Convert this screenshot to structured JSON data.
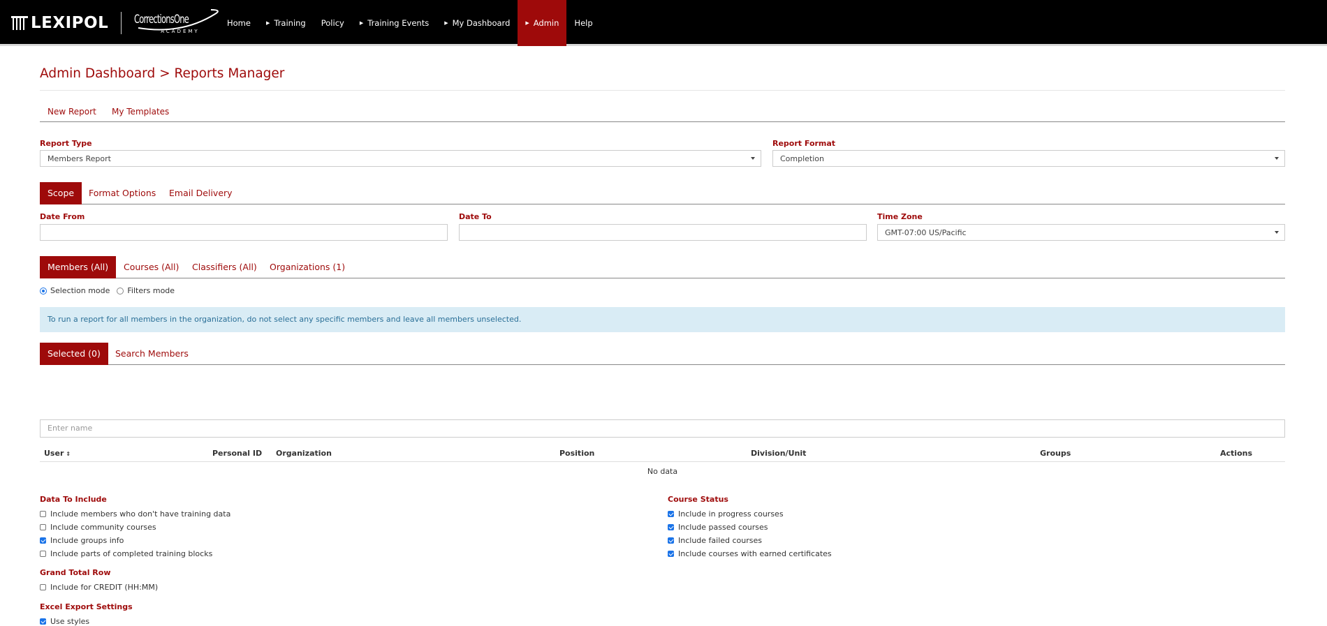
{
  "brand": {
    "lexipol": "LEXIPOL",
    "c1_name": "CorrectionsOne",
    "c1_sub": "ACADEMY"
  },
  "nav": [
    {
      "label": "Home",
      "caret": false,
      "active": false
    },
    {
      "label": "Training",
      "caret": true,
      "active": false
    },
    {
      "label": "Policy",
      "caret": false,
      "active": false
    },
    {
      "label": "Training Events",
      "caret": true,
      "active": false
    },
    {
      "label": "My Dashboard",
      "caret": true,
      "active": false
    },
    {
      "label": "Admin",
      "caret": true,
      "active": true
    },
    {
      "label": "Help",
      "caret": false,
      "active": false
    }
  ],
  "page_title": "Admin Dashboard > Reports Manager",
  "top_tabs": {
    "new_report": "New Report",
    "my_templates": "My Templates"
  },
  "report_type": {
    "label": "Report Type",
    "value": "Members Report"
  },
  "report_format": {
    "label": "Report Format",
    "value": "Completion"
  },
  "config_tabs": {
    "scope": "Scope",
    "format_options": "Format Options",
    "email_delivery": "Email Delivery"
  },
  "date_from": {
    "label": "Date From",
    "value": ""
  },
  "date_to": {
    "label": "Date To",
    "value": ""
  },
  "time_zone": {
    "label": "Time Zone",
    "value": "GMT-07:00 US/Pacific"
  },
  "scope_tabs": {
    "members": "Members (All)",
    "courses": "Courses (All)",
    "classifiers": "Classifiers (All)",
    "organizations": "Organizations (1)"
  },
  "mode": {
    "selection": "Selection mode",
    "filters": "Filters mode",
    "selected": "selection"
  },
  "info_text": "To run a report for all members in the organization, do not select any specific members and leave all members unselected.",
  "member_tabs": {
    "selected": "Selected (0)",
    "search": "Search Members"
  },
  "name_input": {
    "placeholder": "Enter name",
    "value": ""
  },
  "table": {
    "columns": [
      "User",
      "Personal ID",
      "Organization",
      "Position",
      "Division/Unit",
      "Groups",
      "Actions"
    ],
    "empty_text": "No data"
  },
  "data_to_include": {
    "title": "Data To Include",
    "items": [
      {
        "label": "Include members who don't have training data",
        "checked": false
      },
      {
        "label": "Include community courses",
        "checked": false
      },
      {
        "label": "Include groups info",
        "checked": true
      },
      {
        "label": "Include parts of completed training blocks",
        "checked": false
      }
    ]
  },
  "course_status": {
    "title": "Course Status",
    "items": [
      {
        "label": "Include in progress courses",
        "checked": true
      },
      {
        "label": "Include passed courses",
        "checked": true
      },
      {
        "label": "Include failed courses",
        "checked": true
      },
      {
        "label": "Include courses with earned certificates",
        "checked": true
      }
    ]
  },
  "grand_total": {
    "title": "Grand Total Row",
    "items": [
      {
        "label": "Include for CREDIT (HH:MM)",
        "checked": false
      }
    ]
  },
  "excel_export": {
    "title": "Excel Export Settings",
    "items": [
      {
        "label": "Use styles",
        "checked": true
      }
    ]
  },
  "colors": {
    "accent": "#9e0a0a",
    "nav_bg": "#000000",
    "info_bg": "#d9ecf5",
    "info_text": "#2a6f97",
    "checkbox": "#1a73e8"
  }
}
